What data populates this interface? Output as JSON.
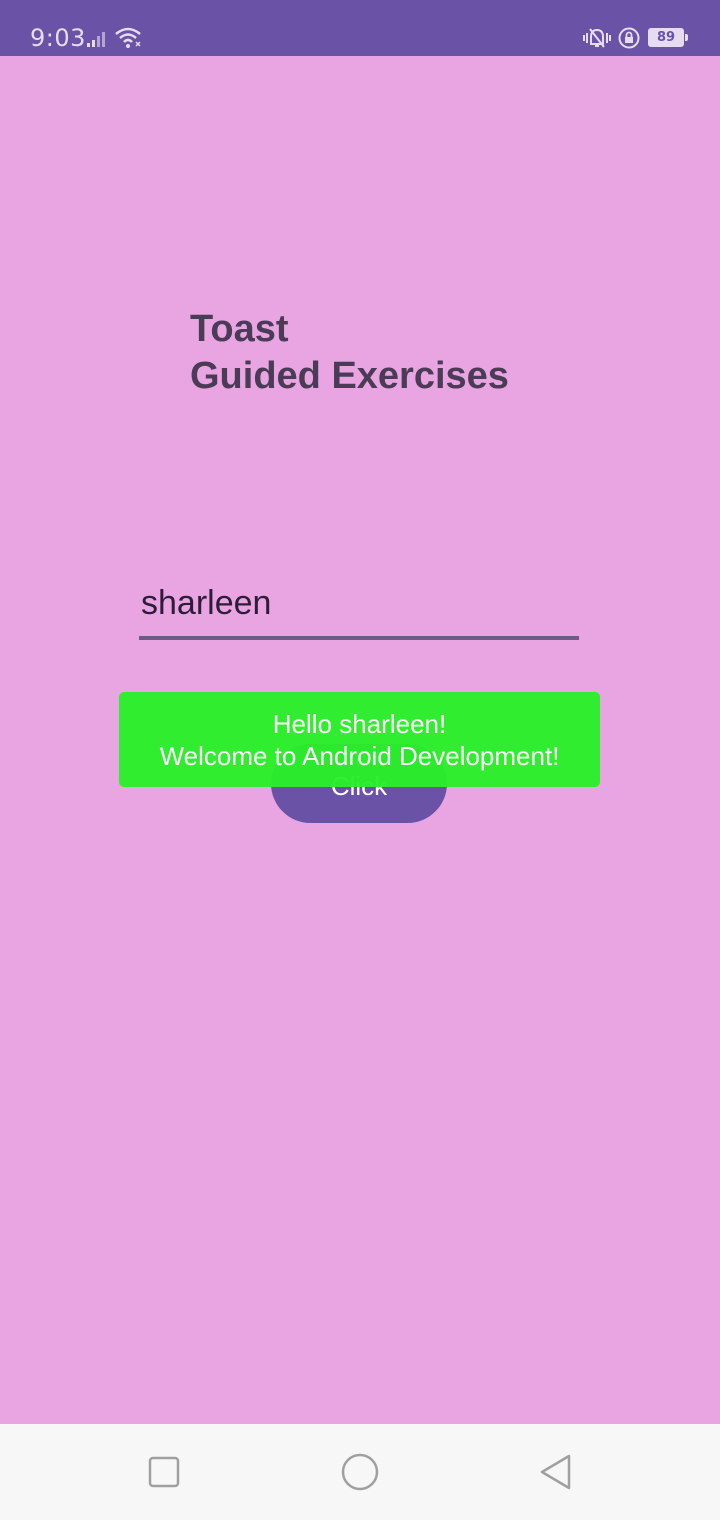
{
  "status_bar": {
    "time": "9:03",
    "battery_level": "89",
    "icons": [
      "signal-icon",
      "wifi-icon",
      "vibrate-icon",
      "rotation-lock-icon",
      "battery-icon"
    ],
    "background_color": "#6a52a7"
  },
  "app": {
    "background_color": "#e9a4e2",
    "title_line1": "Toast",
    "title_line2": "Guided Exercises",
    "name_input_value": "sharleen",
    "click_button_label": "Click",
    "button_color": "#6a52a7"
  },
  "toast": {
    "line1": "Hello sharleen!",
    "line2": "Welcome to Android Development!",
    "background_color": "#29f029"
  },
  "nav_bar": {
    "buttons": [
      "recents-icon",
      "home-icon",
      "back-icon"
    ]
  }
}
